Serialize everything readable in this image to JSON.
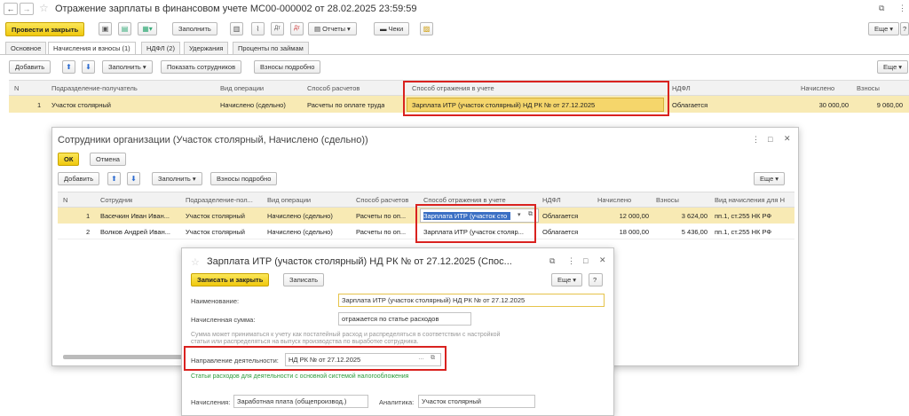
{
  "window": {
    "title": "Отражение зарплаты в финансовом учете МС00-000002 от 28.02.2025 23:59:59"
  },
  "toolbar": {
    "post_close": "Провести и закрыть",
    "fill": "Заполнить",
    "reports": "Отчеты",
    "checks": "Чеки",
    "more": "Еще",
    "more_arrow": "▾",
    "help": "?"
  },
  "tabs": [
    "Основное",
    "Начисления и взносы (1)",
    "НДФЛ (2)",
    "Удержания",
    "Проценты по займам"
  ],
  "tab_toolbar": {
    "add": "Добавить",
    "fill": "Заполнить",
    "show_employees": "Показать сотрудников",
    "contrib_detail": "Взносы подробно",
    "more": "Еще"
  },
  "main_table": {
    "headers": [
      "N",
      "Подразделение-получатель",
      "Вид операции",
      "Способ расчетов",
      "Способ отражения в учете",
      "НДФЛ",
      "Начислено",
      "Взносы"
    ],
    "row": {
      "n": "1",
      "dept": "Участок столярный",
      "op": "Начислено (сдельно)",
      "calc": "Расчеты по оплате труда",
      "reflect": "Зарплата ИТР (участок столярный) НД РК № от 27.12.2025",
      "ndfl": "Облагается",
      "accrued": "30 000,00",
      "contrib": "9 060,00"
    }
  },
  "dialog1": {
    "title": "Сотрудники организации (Участок столярный, Начислено (сдельно))",
    "ok": "ОК",
    "cancel": "Отмена",
    "add": "Добавить",
    "fill": "Заполнить",
    "contrib_detail": "Взносы подробно",
    "more": "Еще",
    "headers": [
      "N",
      "Сотрудник",
      "Подразделение-пол...",
      "Вид операции",
      "Способ расчетов",
      "Способ отражения в учете",
      "НДФЛ",
      "Начислено",
      "Взносы",
      "Вид начисления для Н"
    ],
    "rows": [
      {
        "n": "1",
        "emp": "Васечкин Иван Иван...",
        "dept": "Участок столярный",
        "op": "Начислено (сдельно)",
        "calc": "Расчеты по оп...",
        "reflect": "Зарплата ИТР (участок сто",
        "ndfl": "Облагается",
        "accrued": "12 000,00",
        "contrib": "3 624,00",
        "kind": "пп.1, ст.255 НК РФ"
      },
      {
        "n": "2",
        "emp": "Волков Андрей Иван...",
        "dept": "Участок столярный",
        "op": "Начислено (сдельно)",
        "calc": "Расчеты по оп...",
        "reflect": "Зарплата ИТР (участок столяр...",
        "ndfl": "Облагается",
        "accrued": "18 000,00",
        "contrib": "5 436,00",
        "kind": "пп.1, ст.255 НК РФ"
      }
    ]
  },
  "dialog2": {
    "title": "Зарплата ИТР (участок столярный) НД РК № от 27.12.2025 (Спос...",
    "save_close": "Записать и закрыть",
    "save": "Записать",
    "more": "Еще",
    "help": "?",
    "name_label": "Наименование:",
    "name_value": "Зарплата ИТР (участок столярный) НД РК № от 27.12.2025",
    "sum_label": "Начисленная сумма:",
    "sum_value": "отражается по статье расходов",
    "hint": "Сумма может приниматься к учету как постатейный расход и распределяться в соответствии с настройкой статьи или распределяться на выпуск производства по выработке сотрудника.",
    "dir_label": "Направление деятельности:",
    "dir_value": "НД РК № от 27.12.2025",
    "green_note": "Статьи расходов для деятельности с основной системой налогообложения",
    "accr_label": "Начисления:",
    "accr_value": "Заработная плата (общепроизвод.)",
    "analytic_label": "Аналитика:",
    "analytic_value": "Участок столярный"
  }
}
